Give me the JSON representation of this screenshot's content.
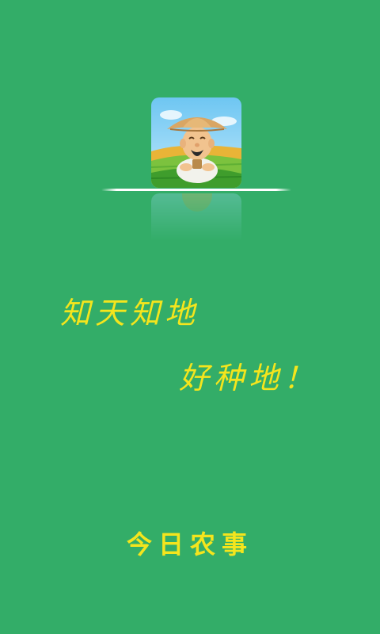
{
  "splash": {
    "logo_icon": "farmer-icon",
    "slogan_line1": "知天知地",
    "slogan_line2": "好种地！",
    "app_name": "今日农事"
  },
  "colors": {
    "background": "#33ad68",
    "text_accent": "#f4e51d",
    "divider": "#ffffff"
  }
}
